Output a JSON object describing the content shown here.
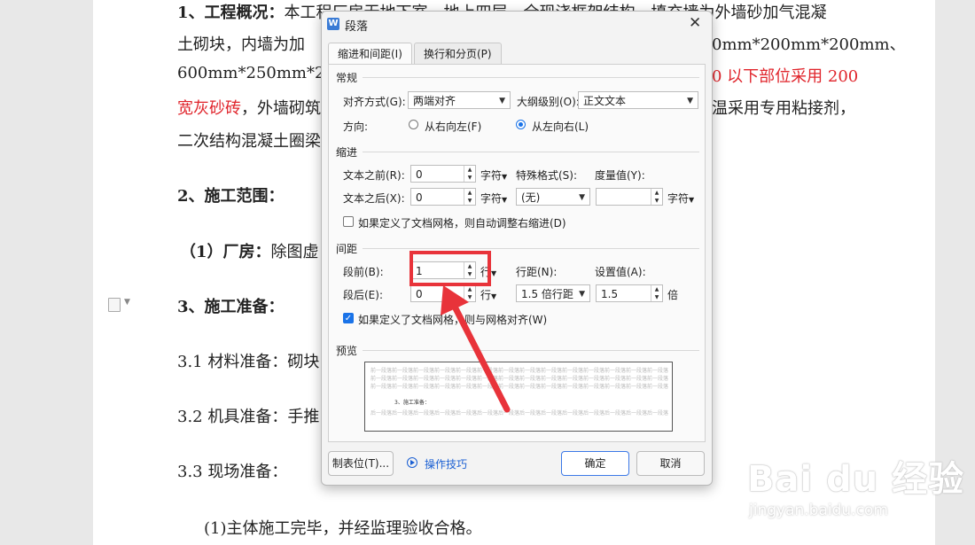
{
  "document": {
    "line1_bold": "1、工程概况：",
    "line1_text": "本工程厂房无地下室、地上四层，全现浇框架结构，填充墙为外墙砂加气混凝",
    "line2_text": "土砌块，内墙为加",
    "line2_right": "0mm*200mm*200mm、",
    "line3_text": "600mm*250mm*200mm",
    "line3_red": "0 以下部位采用 200",
    "line4_red": "宽灰砂砖",
    "line4_text": "，外墙砌筑",
    "line4_right": "温采用专用粘接剂，",
    "line5_text": "二次结构混凝土圈梁",
    "h2": "2、施工范围：",
    "item1_bold": "（1）厂房：",
    "item1_text": "除图虚",
    "h3": "3、施工准备：",
    "s31": "3.1 材料准备：砌块",
    "s32": "3.2 机具准备：手推",
    "s33": "3.3 现场准备：",
    "p1": "(1)主体施工完毕，并经监理验收合格。"
  },
  "dialog": {
    "title": "段落",
    "app_icon_letter": "W",
    "tabs": [
      "缩进和间距(I)",
      "换行和分页(P)"
    ],
    "general": {
      "section": "常规",
      "align_label": "对齐方式(G):",
      "align_value": "两端对齐",
      "outline_label": "大纲级别(O):",
      "outline_value": "正文文本",
      "direction_label": "方向:",
      "rtl_label": "从右向左(F)",
      "ltr_label": "从左向右(L)"
    },
    "indent": {
      "section": "缩进",
      "before_label": "文本之前(R):",
      "before_value": "0",
      "before_unit": "字符",
      "after_label": "文本之后(X):",
      "after_value": "0",
      "after_unit": "字符",
      "special_label": "特殊格式(S):",
      "special_value": "(无)",
      "measure_label": "度量值(Y):",
      "measure_value": "",
      "measure_unit": "字符",
      "auto_adjust_label": "如果定义了文档网格，则自动调整右缩进(D)"
    },
    "spacing": {
      "section": "间距",
      "before_label": "段前(B):",
      "before_value": "1",
      "before_unit": "行",
      "after_label": "段后(E):",
      "after_value": "0",
      "after_unit": "行",
      "line_label": "行距(N):",
      "line_value": "1.5 倍行距",
      "setting_label": "设置值(A):",
      "setting_value": "1.5",
      "setting_unit": "倍",
      "snap_grid_label": "如果定义了文档网格，则与网格对齐(W)"
    },
    "preview": {
      "section": "预览",
      "prev_para": "前一段落前一段落前一段落前一段落前一段落前一段落前一段落前一段落前一段落前一段落前一段落前一段落前一段落前一段落",
      "current_para": "3、施工准备：",
      "next_para": "后一段落后一段落后一段落后一段落后一段落后一段落后一段落后一段落后一段落后一段落后一段落后一段落后一段落后一段落"
    },
    "buttons": {
      "tabs": "制表位(T)...",
      "tips": "操作技巧",
      "ok": "确定",
      "cancel": "取消"
    }
  },
  "watermark": {
    "logo": "Bai du 经验",
    "url": "jingyan.baidu.com"
  },
  "colors": {
    "accent": "#1a73e8",
    "highlight": "#e8333a",
    "red_text": "#e0242b"
  }
}
